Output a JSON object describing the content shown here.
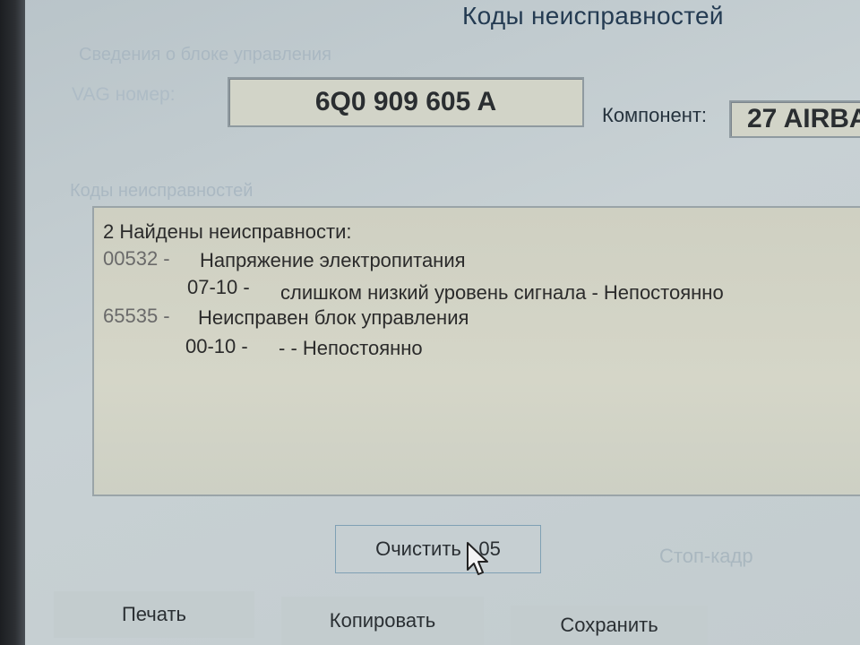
{
  "window": {
    "title": "Коды неисправностей"
  },
  "module_info": {
    "group_label": "Сведения о блоке управления",
    "vag_label": "VAG номер:",
    "vag_number": "6Q0 909 605 A",
    "component_label": "Компонент:",
    "component_value": "27 AIRBA"
  },
  "faults": {
    "group_label": "Коды неисправностей",
    "header": "2 Найдены неисправности:",
    "entries": [
      {
        "code": "00532 -",
        "description": "Напряжение электропитания",
        "sub_code": "07-10 -",
        "sub_description": "слишком низкий уровень сигнала - Непостоянно"
      },
      {
        "code": "65535 -",
        "description": "Неисправен блок управления",
        "sub_code": "00-10 -",
        "sub_description": "- - Непостоянно"
      }
    ]
  },
  "buttons": {
    "clear": "Очистить - 05",
    "freeze_frame": "Стоп-кадр",
    "print": "Печать",
    "copy": "Копировать",
    "save": "Сохранить"
  },
  "colors": {
    "screen_bg": "#c3ccce",
    "field_bg": "#d2d4c8",
    "text_dark": "#2a2e31",
    "disabled_text": "#a9b7bf"
  }
}
